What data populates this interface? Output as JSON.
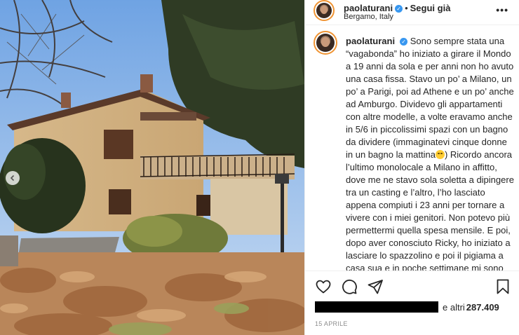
{
  "post": {
    "username": "paolaturani",
    "verified_mark": "✓",
    "separator": "•",
    "follow_label": "Segui già",
    "location": "Bergamo, Italy",
    "more_label": "•••",
    "caption_text_1": "Sono sempre stata una “vagabonda” ho iniziato a girare il Mondo a 19 anni da sola e per anni non ho avuto una casa fissa. Stavo un po’ a Milano, un po’ a Parigi, poi ad Athene e un po’ anche ad Amburgo. Dividevo gli appartamenti con altre modelle, a volte eravamo anche in 5/6 in piccolissimi spazi con un bagno da dividere (immaginatevi cinque donne in un bagno la mattina",
    "caption_emoji": "grinning-sweat-emoji",
    "caption_text_2": ") Ricordo ancora l’ultimo monolocale a Milano in affitto, dove me ne stavo sola soletta a dipingere tra un casting e l’altro, l’ho lasciato appena compiuti i 23 anni per tornare a vivere con i miei genitori. Non potevo più permettermi quella spesa mensile. E poi, dopo aver conosciuto Ricky, ho iniziato a lasciare lo spazzolino e poi il pigiama a casa sua e in poche settimane mi sono",
    "likes_prefix": "e altri",
    "likes_count": "287.409",
    "date": "15 APRILE"
  },
  "icons": {
    "prev": "chevron-left-icon",
    "like": "heart-icon",
    "comment": "comment-icon",
    "share": "send-icon",
    "save": "bookmark-icon"
  },
  "colors": {
    "text": "#262626",
    "secondary": "#8e8e8e",
    "verified": "#3897f0",
    "divider": "#efefef"
  }
}
